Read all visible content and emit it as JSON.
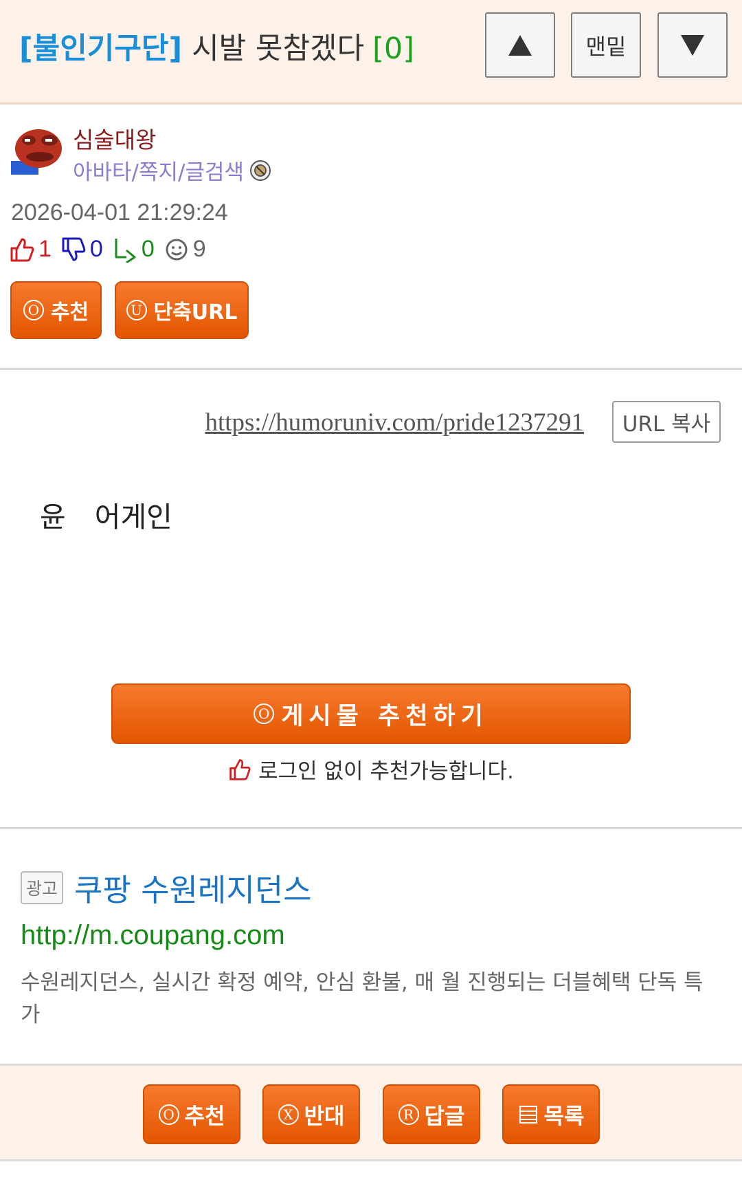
{
  "header": {
    "category": "[불인기구단]",
    "subject": "시발 못참겠다",
    "comment_count": "[0]",
    "nav_bottom_label": "맨밑"
  },
  "author": {
    "name": "심술대왕",
    "links": "아바타/쪽지/글검색"
  },
  "post": {
    "datetime": "2026-04-01 21:29:24",
    "stats": {
      "up": "1",
      "down": "0",
      "replies": "0",
      "views": "9"
    },
    "buttons": {
      "recommend": "추천",
      "short_url": "단축URL"
    },
    "url": "https://humoruniv.com/pride1237291",
    "url_copy_label": "URL 복사",
    "body_word1": "윤",
    "body_word2": "어게인",
    "recommend_big_label": "게시물 추천하기",
    "recommend_note": "로그인 없이 추천가능합니다."
  },
  "ad": {
    "badge": "광고",
    "title": "쿠팡 수원레지던스",
    "url": "http://m.coupang.com",
    "description": "수원레지던스, 실시간 확정 예약, 안심 환불, 매 월 진행되는 더블혜택 단독 특가"
  },
  "footer": {
    "recommend": "추천",
    "oppose": "반대",
    "reply": "답글",
    "list": "목록"
  },
  "icon_letters": {
    "recommend": "O",
    "short_url": "U",
    "oppose": "X",
    "reply": "R"
  },
  "colors": {
    "accent_orange": "#e35600",
    "link_blue": "#1a8fd8",
    "green": "#1fa11f"
  }
}
